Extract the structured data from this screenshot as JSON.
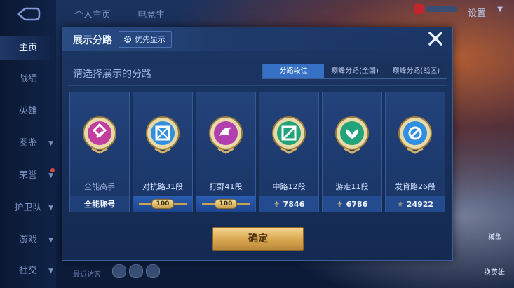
{
  "sidebar": {
    "items": [
      {
        "label": "主页",
        "active": true
      },
      {
        "label": "战绩"
      },
      {
        "label": "英雄"
      },
      {
        "label": "图鉴"
      },
      {
        "label": "荣誉"
      },
      {
        "label": "护卫队"
      },
      {
        "label": "游戏"
      },
      {
        "label": "社交"
      }
    ]
  },
  "topbar": {
    "tabs": [
      "个人主页",
      "电竞生"
    ],
    "settings_label": "设置"
  },
  "background_labels": {
    "bottom_hint": "最近访客",
    "right_top": "模型",
    "right_bottom": "换英雄"
  },
  "dialog": {
    "title": "展示分路",
    "priority_button": "优先显示",
    "subtitle": "请选择展示的分路",
    "segments": [
      "分路段位",
      "巅峰分路(全国)",
      "巅峰分路(战区)"
    ],
    "active_segment": 0,
    "cards": [
      {
        "name": "全能高手",
        "footer": "全能称号",
        "footer_type": "text",
        "badge_color": "#c23fa0",
        "icon": "all-round-icon"
      },
      {
        "name": "对抗路31段",
        "footer": "100",
        "footer_type": "ribbon",
        "badge_color": "#2f8fe0",
        "icon": "clash-lane-icon"
      },
      {
        "name": "打野41段",
        "footer": "100",
        "footer_type": "ribbon",
        "badge_color": "#b23fb0",
        "icon": "jungle-icon"
      },
      {
        "name": "中路12段",
        "footer": "7846",
        "footer_type": "score",
        "badge_color": "#22a37a",
        "icon": "mid-lane-icon"
      },
      {
        "name": "游走11段",
        "footer": "6786",
        "footer_type": "score",
        "badge_color": "#22a37a",
        "icon": "roam-icon"
      },
      {
        "name": "发育路26段",
        "footer": "24922",
        "footer_type": "score",
        "badge_color": "#2f8fe0",
        "icon": "farm-lane-icon"
      }
    ],
    "confirm_label": "确定"
  },
  "colors": {
    "accent": "#3671c6",
    "confirm_gold": "#d8a54e"
  }
}
